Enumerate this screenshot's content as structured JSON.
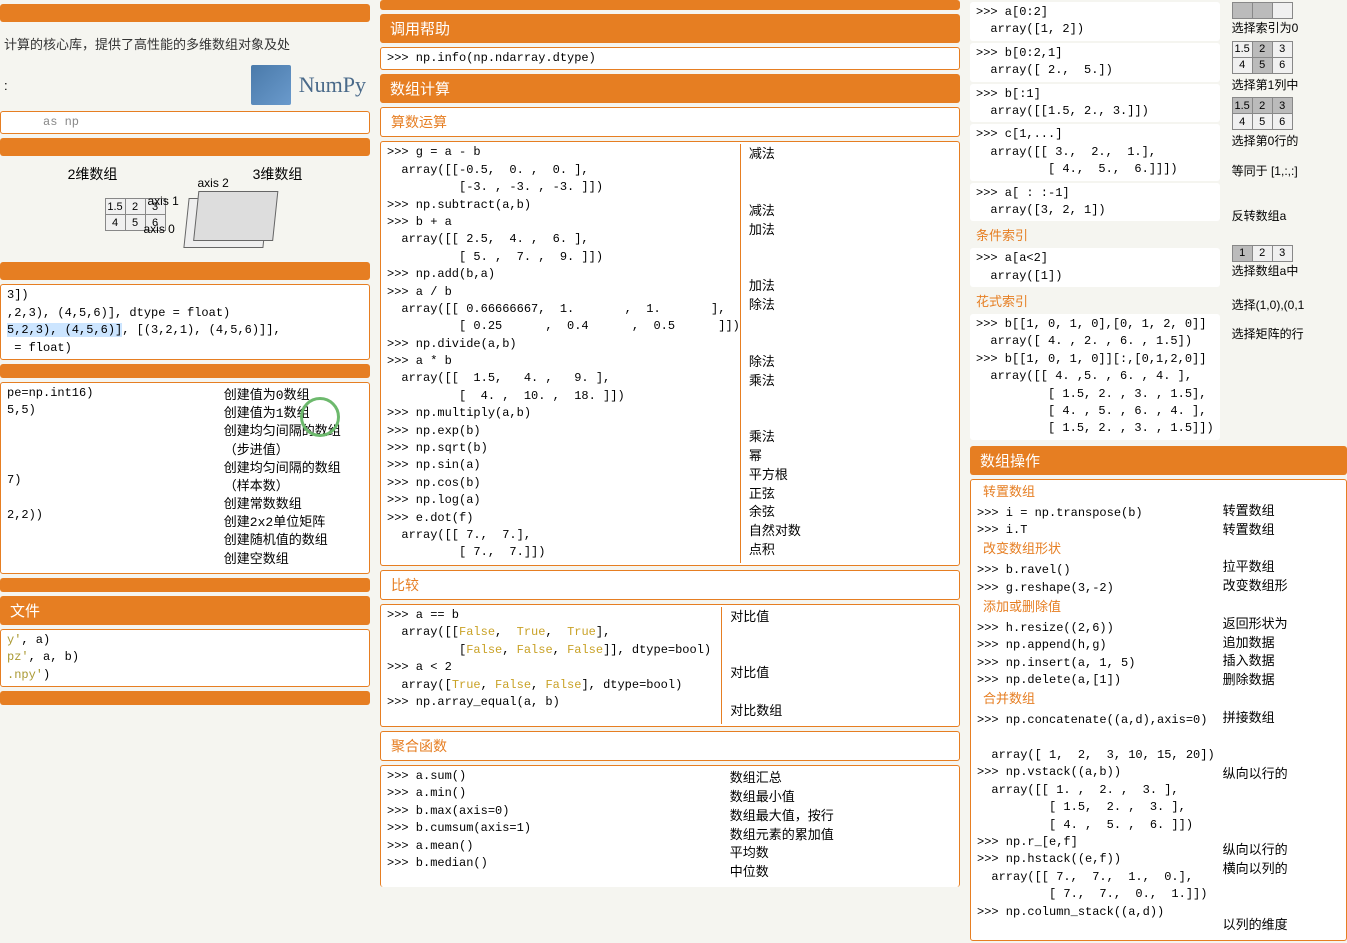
{
  "col1": {
    "intro_text": "计算的核心库，提供了高性能的多维数组对象及处",
    "numpy_label": "NumPy",
    "import_code": "     as np",
    "dim2_label": "2维数组",
    "dim3_label": "3维数组",
    "axis2": "axis 2",
    "axis1": "axis 1",
    "axis0": "axis 0",
    "arr2d": [
      [
        "1.5",
        "2",
        "3"
      ],
      [
        "4",
        "5",
        "6"
      ]
    ],
    "create_code": "3])\n,2,3), (4,5,6)], dtype = float)\n5,2,3), (4,5,6)], [(3,2,1), (4,5,6)]],\n = float)",
    "create_sel": "5,2,3), (4,5,6)]",
    "helpers_code": "pe=np.int16)\n5,5)\n\n\n\n7)\n\n2,2))",
    "helpers_desc": [
      "创建值为0数组",
      "创建值为1数组",
      "创建均匀间隔的数组（步进值）",
      "",
      "创建均匀间隔的数组（样本数）",
      "",
      "创建常数数组",
      "创建2x2单位矩阵",
      "创建随机值的数组",
      "创建空数组"
    ],
    "io_header": "文件",
    "io_code": "y', a)\npz', a, b)\n.npy')"
  },
  "col2": {
    "help_header": "调用帮助",
    "help_code": ">>> np.info(np.ndarray.dtype)",
    "calc_header": "数组计算",
    "arith_header": "算数运算",
    "arith_code": ">>> g = a - b\n  array([[-0.5,  0. ,  0. ],\n          [-3. , -3. , -3. ]])\n>>> np.subtract(a,b)\n>>> b + a\n  array([[ 2.5,  4. ,  6. ],\n          [ 5. ,  7. ,  9. ]])\n>>> np.add(b,a)\n>>> a / b\n  array([[ 0.66666667,  1.       ,  1.       ],\n          [ 0.25      ,  0.4      ,  0.5      ]])\n>>> np.divide(a,b)\n>>> a * b\n  array([[  1.5,   4. ,   9. ],\n          [  4. ,  10. ,  18. ]])\n>>> np.multiply(a,b)\n>>> np.exp(b)\n>>> np.sqrt(b)\n>>> np.sin(a)\n>>> np.cos(b)\n>>> np.log(a)\n>>> e.dot(f)\n  array([[ 7.,  7.],\n          [ 7.,  7.]])",
    "arith_desc": [
      "减法",
      "",
      "",
      "减法",
      "加法",
      "",
      "",
      "加法",
      "除法",
      "",
      "",
      "除法",
      "乘法",
      "",
      "",
      "乘法",
      "幂",
      "平方根",
      "正弦",
      "余弦",
      "自然对数",
      "点积"
    ],
    "compare_header": "比较",
    "compare_desc": [
      "对比值",
      "",
      "",
      "对比值",
      "",
      "对比数组"
    ],
    "agg_header": "聚合函数",
    "agg_code": ">>> a.sum()\n>>> a.min()\n>>> b.max(axis=0)\n>>> b.cumsum(axis=1)\n>>> a.mean()\n>>> b.median()",
    "agg_desc": [
      "数组汇总",
      "数组最小值",
      "数组最大值，按行",
      "数组元素的累加值",
      "平均数",
      "中位数"
    ]
  },
  "col3": {
    "slice1_code": ">>> a[0:2]\n  array([1, 2])",
    "slice1_desc": "选择索引为0",
    "slice2_code": ">>> b[0:2,1]\n  array([ 2.,  5.])",
    "slice2_desc": "选择第1列中",
    "slice3_code": ">>> b[:1]\n  array([[1.5, 2., 3.]])",
    "slice3_desc": "选择第0行的",
    "slice4_code": ">>> c[1,...]\n  array([[ 3.,  2.,  1.],\n          [ 4.,  5.,  6.]]])",
    "slice4_desc": "等同于 [1,:,:]",
    "slice5_code": ">>> a[ : :-1]\n  array([3, 2, 1])",
    "slice5_desc": "反转数组a",
    "cond_header": "条件索引",
    "cond_code": ">>> a[a<2]\n  array([1])",
    "cond_desc": "选择数组a中",
    "fancy_header": "花式索引",
    "fancy_code": ">>> b[[1, 0, 1, 0],[0, 1, 2, 0]]\n  array([ 4. , 2. , 6. , 1.5])\n>>> b[[1, 0, 1, 0]][:,[0,1,2,0]]\n  array([[ 4. ,5. , 6. , 4. ],\n          [ 1.5, 2. , 3. , 1.5],\n          [ 4. , 5. , 6. , 4. ],\n          [ 1.5, 2. , 3. , 1.5]])",
    "fancy_desc1": "选择(1,0),(0,1",
    "fancy_desc2": "选择矩阵的行",
    "ops_header": "数组操作",
    "transpose_header": "转置数组",
    "transpose_code": ">>> i = np.transpose(b)\n>>> i.T",
    "transpose_desc": [
      "转置数组",
      "转置数组"
    ],
    "reshape_header": "改变数组形状",
    "reshape_code": ">>> b.ravel()\n>>> g.reshape(3,-2)",
    "reshape_desc": [
      "拉平数组",
      "改变数组形"
    ],
    "addrem_header": "添加或删除值",
    "addrem_code": ">>> h.resize((2,6))\n>>> np.append(h,g)\n>>> np.insert(a, 1, 5)\n>>> np.delete(a,[1])",
    "addrem_desc": [
      "返回形状为",
      "追加数据",
      "插入数据",
      "删除数据"
    ],
    "merge_header": "合并数组",
    "merge_code": ">>> np.concatenate((a,d),axis=0)\n\n  array([ 1,  2,  3, 10, 15, 20])\n>>> np.vstack((a,b))\n  array([[ 1. ,  2. ,  3. ],\n          [ 1.5,  2. ,  3. ],\n          [ 4. ,  5. ,  6. ]])\n>>> np.r_[e,f]\n>>> np.hstack((e,f))\n  array([[ 7.,  7.,  1.,  0.],\n          [ 7.,  7.,  0.,  1.]])\n>>> np.column_stack((a,d))",
    "merge_desc": [
      "拼接数组",
      "",
      "",
      "纵向以行的",
      "",
      "",
      "",
      "纵向以行的",
      "横向以列的",
      "",
      "",
      "以列的维度"
    ],
    "mt1": [
      [
        "1.5",
        "2",
        "3"
      ],
      [
        "4",
        "5",
        "6"
      ]
    ],
    "mt2": [
      [
        "1.5",
        "2",
        "3"
      ],
      [
        "4",
        "5",
        "6"
      ]
    ],
    "mt3": [
      [
        "1",
        "2",
        "3"
      ]
    ]
  }
}
